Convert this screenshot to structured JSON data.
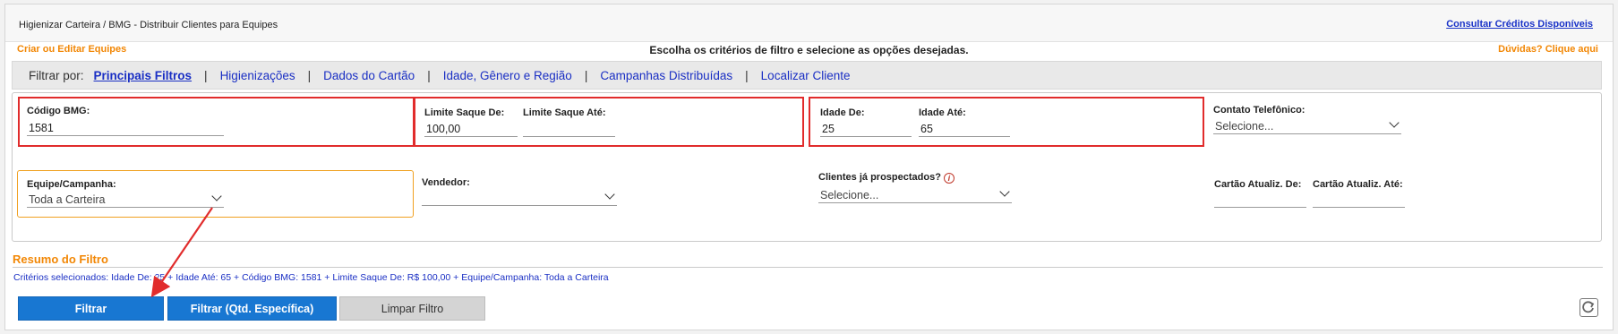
{
  "header": {
    "breadcrumb": "Higienizar Carteira / BMG - Distribuir Clientes para Equipes",
    "credits_link": "Consultar Créditos Disponíveis"
  },
  "links": {
    "teams": "Criar ou Editar Equipes",
    "help": "Dúvidas? Clique aqui",
    "instruction": "Escolha os critérios de filtro e selecione as opções desejadas."
  },
  "tabs": {
    "label": "Filtrar por:",
    "items": [
      {
        "label": "Principais Filtros",
        "active": true
      },
      {
        "label": "Higienizações"
      },
      {
        "label": "Dados do Cartão"
      },
      {
        "label": "Idade, Gênero e Região"
      },
      {
        "label": "Campanhas Distribuídas"
      },
      {
        "label": "Localizar Cliente"
      }
    ]
  },
  "fields": {
    "codigo_bmg": {
      "label": "Código BMG:",
      "value": "1581"
    },
    "limite_de": {
      "label": "Limite Saque De:",
      "value": "100,00"
    },
    "limite_ate": {
      "label": "Limite Saque Até:",
      "value": ""
    },
    "idade_de": {
      "label": "Idade De:",
      "value": "25"
    },
    "idade_ate": {
      "label": "Idade Até:",
      "value": "65"
    },
    "contato": {
      "label": "Contato Telefônico:",
      "value": "Selecione..."
    },
    "equipe": {
      "label": "Equipe/Campanha:",
      "value": "Toda a Carteira"
    },
    "vendedor": {
      "label": "Vendedor:",
      "value": ""
    },
    "prospectados": {
      "label": "Clientes já prospectados?",
      "value": "Selecione..."
    },
    "cartao_de": {
      "label": "Cartão Atualiz. De:",
      "value": ""
    },
    "cartao_ate": {
      "label": "Cartão Atualiz. Até:",
      "value": ""
    }
  },
  "summary": {
    "title": "Resumo do Filtro",
    "criteria": "Critérios selecionados: Idade De: 25 + Idade Até: 65 + Código BMG: 1581 + Limite Saque De: R$ 100,00 + Equipe/Campanha: Toda a Carteira"
  },
  "buttons": {
    "filter": "Filtrar",
    "filter_qty": "Filtrar (Qtd. Específica)",
    "clear": "Limpar Filtro"
  },
  "icons": {
    "info": "info-icon",
    "refresh": "refresh-icon",
    "chevron": "chevron-down-icon"
  },
  "colors": {
    "link_blue": "#1a2fc4",
    "orange": "#f28705",
    "highlight_red": "#e12c2c",
    "button_blue": "#1877d2"
  }
}
